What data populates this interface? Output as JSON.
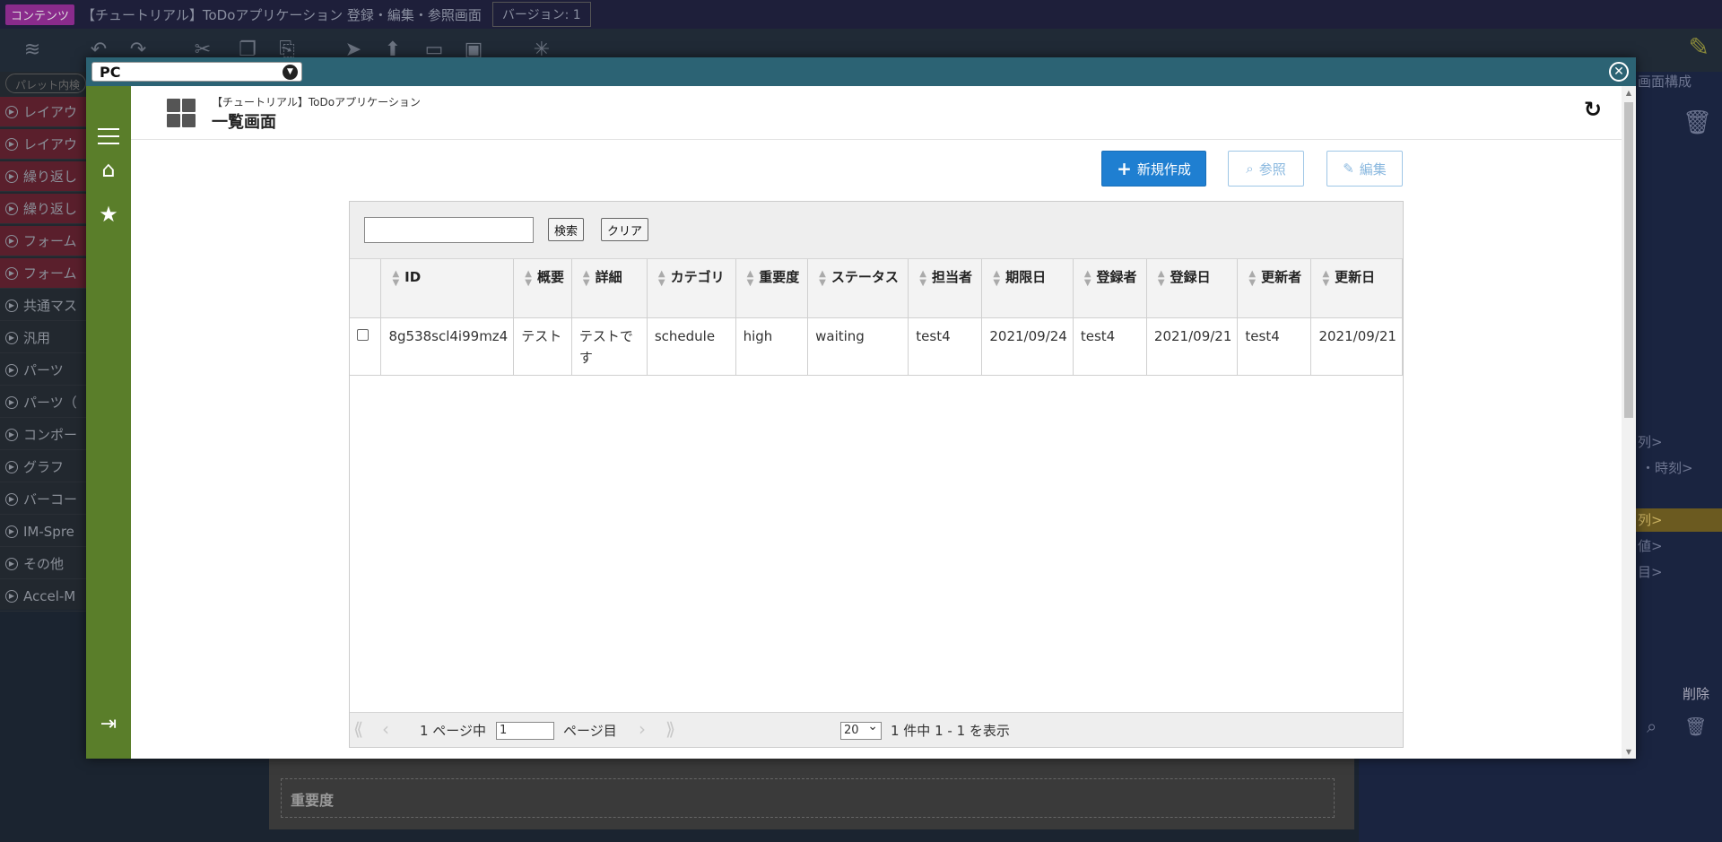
{
  "ide": {
    "tag": "コンテンツ",
    "title": "【チュートリアル】ToDoアプリケーション 登録・編集・参照画面",
    "version": "バージョン: 1",
    "palette_search": "パレット内検",
    "categories": [
      "レイアウ",
      "レイアウ",
      "繰り返し",
      "繰り返し",
      "フォーム",
      "フォーム",
      "共通マス",
      "汎用",
      "パーツ",
      "パーツ（",
      "コンポー",
      "グラフ",
      "バーコー",
      "IM-Spre",
      "その他",
      "Accel-M"
    ],
    "right_labels": {
      "screen_config": "画面構成",
      "col": "列>",
      "time_col": "・時刻>",
      "col2": "列>",
      "value": "値>",
      "item": "目>",
      "delete": "削除"
    },
    "field_label": "重要度"
  },
  "modal": {
    "device": "PC",
    "app_name": "【チュートリアル】ToDoアプリケーション",
    "page_title": "一覧画面",
    "buttons": {
      "new": "新規作成",
      "ref": "参照",
      "edit": "編集"
    },
    "search": {
      "value": "",
      "search_btn": "検索",
      "clear_btn": "クリア"
    },
    "columns": [
      "ID",
      "概要",
      "詳細",
      "カテゴリ",
      "重要度",
      "ステータス",
      "担当者",
      "期限日",
      "登録者",
      "登録日",
      "更新者",
      "更新日"
    ],
    "rows": [
      {
        "id": "8g538scl4i99mz4",
        "summary": "テスト",
        "detail": "テストです",
        "category": "schedule",
        "priority": "high",
        "status": "waiting",
        "assignee": "test4",
        "due": "2021/09/24",
        "creator": "test4",
        "created": "2021/09/21",
        "updater": "test4",
        "updated": "2021/09/21"
      }
    ],
    "footer": {
      "page_of": "1 ページ中",
      "page_value": "1",
      "page_suffix": "ページ目",
      "rows_per_page": "20",
      "summary": "1 件中 1 - 1 を表示"
    }
  }
}
